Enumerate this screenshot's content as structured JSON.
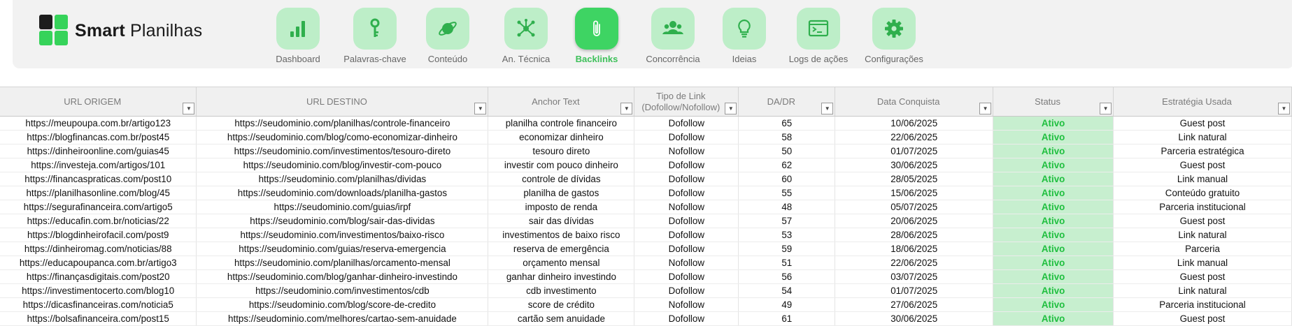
{
  "logo": {
    "bold": "Smart",
    "rest": " Planilhas"
  },
  "nav": [
    {
      "label": "Dashboard",
      "icon": "bar-chart-icon",
      "active": false
    },
    {
      "label": "Palavras-chave",
      "icon": "key-icon",
      "active": false
    },
    {
      "label": "Conteúdo",
      "icon": "planet-icon",
      "active": false
    },
    {
      "label": "An. Técnica",
      "icon": "network-icon",
      "active": false
    },
    {
      "label": "Backlinks",
      "icon": "paperclip-icon",
      "active": true
    },
    {
      "label": "Concorrência",
      "icon": "group-icon",
      "active": false
    },
    {
      "label": "Ideias",
      "icon": "lightbulb-icon",
      "active": false
    },
    {
      "label": "Logs de ações",
      "icon": "terminal-icon",
      "active": false
    },
    {
      "label": "Configurações",
      "icon": "gear-icon",
      "active": false
    }
  ],
  "table": {
    "columns": [
      "URL ORIGEM",
      "URL DESTINO",
      "Anchor Text",
      "Tipo de Link (Dofollow/Nofollow)",
      "DA/DR",
      "Data Conquista",
      "Status",
      "Estratégia Usada"
    ],
    "filter_glyph": "▼",
    "rows": [
      [
        "https://meupoupa.com.br/artigo123",
        "https://seudominio.com/planilhas/controle-financeiro",
        "planilha controle financeiro",
        "Dofollow",
        "65",
        "10/06/2025",
        "Ativo",
        "Guest post"
      ],
      [
        "https://blogfinancas.com.br/post45",
        "https://seudominio.com/blog/como-economizar-dinheiro",
        "economizar dinheiro",
        "Dofollow",
        "58",
        "22/06/2025",
        "Ativo",
        "Link natural"
      ],
      [
        "https://dinheiroonline.com/guias45",
        "https://seudominio.com/investimentos/tesouro-direto",
        "tesouro direto",
        "Nofollow",
        "50",
        "01/07/2025",
        "Ativo",
        "Parceria estratégica"
      ],
      [
        "https://investeja.com/artigos/101",
        "https://seudominio.com/blog/investir-com-pouco",
        "investir com pouco dinheiro",
        "Dofollow",
        "62",
        "30/06/2025",
        "Ativo",
        "Guest post"
      ],
      [
        "https://financaspraticas.com/post10",
        "https://seudominio.com/planilhas/dividas",
        "controle de dívidas",
        "Dofollow",
        "60",
        "28/05/2025",
        "Ativo",
        "Link manual"
      ],
      [
        "https://planilhasonline.com/blog/45",
        "https://seudominio.com/downloads/planilha-gastos",
        "planilha de gastos",
        "Dofollow",
        "55",
        "15/06/2025",
        "Ativo",
        "Conteúdo gratuito"
      ],
      [
        "https://segurafinanceira.com/artigo5",
        "https://seudominio.com/guias/irpf",
        "imposto de renda",
        "Nofollow",
        "48",
        "05/07/2025",
        "Ativo",
        "Parceria institucional"
      ],
      [
        "https://educafin.com.br/noticias/22",
        "https://seudominio.com/blog/sair-das-dividas",
        "sair das dívidas",
        "Dofollow",
        "57",
        "20/06/2025",
        "Ativo",
        "Guest post"
      ],
      [
        "https://blogdinheirofacil.com/post9",
        "https://seudominio.com/investimentos/baixo-risco",
        "investimentos de baixo risco",
        "Dofollow",
        "53",
        "28/06/2025",
        "Ativo",
        "Link natural"
      ],
      [
        "https://dinheiromag.com/noticias/88",
        "https://seudominio.com/guias/reserva-emergencia",
        "reserva de emergência",
        "Dofollow",
        "59",
        "18/06/2025",
        "Ativo",
        "Parceria"
      ],
      [
        "https://educapoupanca.com.br/artigo3",
        "https://seudominio.com/planilhas/orcamento-mensal",
        "orçamento mensal",
        "Nofollow",
        "51",
        "22/06/2025",
        "Ativo",
        "Link manual"
      ],
      [
        "https://finançasdigitais.com/post20",
        "https://seudominio.com/blog/ganhar-dinheiro-investindo",
        "ganhar dinheiro investindo",
        "Dofollow",
        "56",
        "03/07/2025",
        "Ativo",
        "Guest post"
      ],
      [
        "https://investimentocerto.com/blog10",
        "https://seudominio.com/investimentos/cdb",
        "cdb investimento",
        "Dofollow",
        "54",
        "01/07/2025",
        "Ativo",
        "Link natural"
      ],
      [
        "https://dicasfinanceiras.com/noticia5",
        "https://seudominio.com/blog/score-de-credito",
        "score de crédito",
        "Nofollow",
        "49",
        "27/06/2025",
        "Ativo",
        "Parceria institucional"
      ],
      [
        "https://bolsafinanceira.com/post15",
        "https://seudominio.com/melhores/cartao-sem-anuidade",
        "cartão sem anuidade",
        "Dofollow",
        "61",
        "30/06/2025",
        "Ativo",
        "Guest post"
      ]
    ]
  }
}
